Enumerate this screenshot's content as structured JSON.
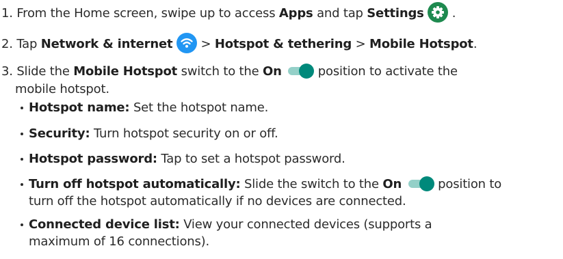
{
  "steps": [
    {
      "n": "1.",
      "t1": "From the Home screen, swipe up to access",
      "apps": "Apps",
      "t2": "and tap",
      "settings": "Settings",
      "t3": "."
    },
    {
      "n": "2.",
      "t1": "Tap",
      "network": "Network & internet",
      "sep1": ">",
      "hotspot_tethering": "Hotspot & tethering",
      "sep2": ">",
      "mobile_hotspot": "Mobile Hotspot",
      "t2": "."
    },
    {
      "n": "3.",
      "t1": "Slide the",
      "mobile_hotspot": "Mobile Hotspot",
      "t2": "switch to the",
      "on": "On",
      "t3": "position to activate the",
      "t4": "mobile hotspot."
    }
  ],
  "bullets": [
    {
      "label": "Hotspot name:",
      "text": "Set the hotspot name."
    },
    {
      "label": "Security:",
      "text": "Turn hotspot security on or off."
    },
    {
      "label": "Hotspot password:",
      "text": "Tap to set a hotspot password."
    },
    {
      "label": "Turn off hotspot automatically:",
      "text": "Slide the switch to the",
      "on": "On",
      "text2": "position to",
      "text3": "turn off the hotspot automatically if no devices are connected."
    },
    {
      "label": "Connected device list:",
      "text": "View your connected devices (supports a",
      "text2": "maximum of 16 connections)."
    }
  ],
  "icons": {
    "settings": "gear-icon",
    "network": "wifi-icon",
    "toggle": "toggle-on-icon"
  },
  "colors": {
    "settings_icon_bg": "#1e8a4f",
    "wifi_icon_bg": "#2196f3",
    "toggle_knob": "#00897b",
    "toggle_track": "#94d0c8",
    "text": "#2b2b2b"
  }
}
